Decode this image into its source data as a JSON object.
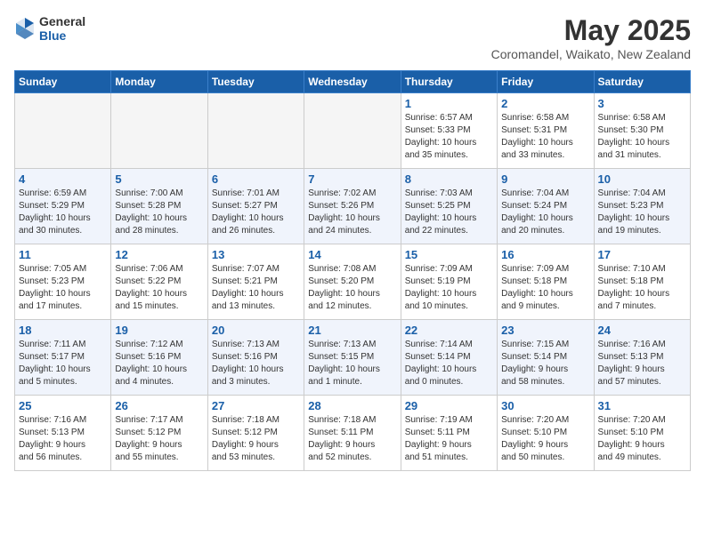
{
  "app": {
    "logo_general": "General",
    "logo_blue": "Blue"
  },
  "header": {
    "month_year": "May 2025",
    "location": "Coromandel, Waikato, New Zealand"
  },
  "days_of_week": [
    "Sunday",
    "Monday",
    "Tuesday",
    "Wednesday",
    "Thursday",
    "Friday",
    "Saturday"
  ],
  "weeks": [
    [
      {
        "num": "",
        "info": "",
        "empty": true
      },
      {
        "num": "",
        "info": "",
        "empty": true
      },
      {
        "num": "",
        "info": "",
        "empty": true
      },
      {
        "num": "",
        "info": "",
        "empty": true
      },
      {
        "num": "1",
        "info": "Sunrise: 6:57 AM\nSunset: 5:33 PM\nDaylight: 10 hours\nand 35 minutes.",
        "empty": false
      },
      {
        "num": "2",
        "info": "Sunrise: 6:58 AM\nSunset: 5:31 PM\nDaylight: 10 hours\nand 33 minutes.",
        "empty": false
      },
      {
        "num": "3",
        "info": "Sunrise: 6:58 AM\nSunset: 5:30 PM\nDaylight: 10 hours\nand 31 minutes.",
        "empty": false
      }
    ],
    [
      {
        "num": "4",
        "info": "Sunrise: 6:59 AM\nSunset: 5:29 PM\nDaylight: 10 hours\nand 30 minutes.",
        "empty": false
      },
      {
        "num": "5",
        "info": "Sunrise: 7:00 AM\nSunset: 5:28 PM\nDaylight: 10 hours\nand 28 minutes.",
        "empty": false
      },
      {
        "num": "6",
        "info": "Sunrise: 7:01 AM\nSunset: 5:27 PM\nDaylight: 10 hours\nand 26 minutes.",
        "empty": false
      },
      {
        "num": "7",
        "info": "Sunrise: 7:02 AM\nSunset: 5:26 PM\nDaylight: 10 hours\nand 24 minutes.",
        "empty": false
      },
      {
        "num": "8",
        "info": "Sunrise: 7:03 AM\nSunset: 5:25 PM\nDaylight: 10 hours\nand 22 minutes.",
        "empty": false
      },
      {
        "num": "9",
        "info": "Sunrise: 7:04 AM\nSunset: 5:24 PM\nDaylight: 10 hours\nand 20 minutes.",
        "empty": false
      },
      {
        "num": "10",
        "info": "Sunrise: 7:04 AM\nSunset: 5:23 PM\nDaylight: 10 hours\nand 19 minutes.",
        "empty": false
      }
    ],
    [
      {
        "num": "11",
        "info": "Sunrise: 7:05 AM\nSunset: 5:23 PM\nDaylight: 10 hours\nand 17 minutes.",
        "empty": false
      },
      {
        "num": "12",
        "info": "Sunrise: 7:06 AM\nSunset: 5:22 PM\nDaylight: 10 hours\nand 15 minutes.",
        "empty": false
      },
      {
        "num": "13",
        "info": "Sunrise: 7:07 AM\nSunset: 5:21 PM\nDaylight: 10 hours\nand 13 minutes.",
        "empty": false
      },
      {
        "num": "14",
        "info": "Sunrise: 7:08 AM\nSunset: 5:20 PM\nDaylight: 10 hours\nand 12 minutes.",
        "empty": false
      },
      {
        "num": "15",
        "info": "Sunrise: 7:09 AM\nSunset: 5:19 PM\nDaylight: 10 hours\nand 10 minutes.",
        "empty": false
      },
      {
        "num": "16",
        "info": "Sunrise: 7:09 AM\nSunset: 5:18 PM\nDaylight: 10 hours\nand 9 minutes.",
        "empty": false
      },
      {
        "num": "17",
        "info": "Sunrise: 7:10 AM\nSunset: 5:18 PM\nDaylight: 10 hours\nand 7 minutes.",
        "empty": false
      }
    ],
    [
      {
        "num": "18",
        "info": "Sunrise: 7:11 AM\nSunset: 5:17 PM\nDaylight: 10 hours\nand 5 minutes.",
        "empty": false
      },
      {
        "num": "19",
        "info": "Sunrise: 7:12 AM\nSunset: 5:16 PM\nDaylight: 10 hours\nand 4 minutes.",
        "empty": false
      },
      {
        "num": "20",
        "info": "Sunrise: 7:13 AM\nSunset: 5:16 PM\nDaylight: 10 hours\nand 3 minutes.",
        "empty": false
      },
      {
        "num": "21",
        "info": "Sunrise: 7:13 AM\nSunset: 5:15 PM\nDaylight: 10 hours\nand 1 minute.",
        "empty": false
      },
      {
        "num": "22",
        "info": "Sunrise: 7:14 AM\nSunset: 5:14 PM\nDaylight: 10 hours\nand 0 minutes.",
        "empty": false
      },
      {
        "num": "23",
        "info": "Sunrise: 7:15 AM\nSunset: 5:14 PM\nDaylight: 9 hours\nand 58 minutes.",
        "empty": false
      },
      {
        "num": "24",
        "info": "Sunrise: 7:16 AM\nSunset: 5:13 PM\nDaylight: 9 hours\nand 57 minutes.",
        "empty": false
      }
    ],
    [
      {
        "num": "25",
        "info": "Sunrise: 7:16 AM\nSunset: 5:13 PM\nDaylight: 9 hours\nand 56 minutes.",
        "empty": false
      },
      {
        "num": "26",
        "info": "Sunrise: 7:17 AM\nSunset: 5:12 PM\nDaylight: 9 hours\nand 55 minutes.",
        "empty": false
      },
      {
        "num": "27",
        "info": "Sunrise: 7:18 AM\nSunset: 5:12 PM\nDaylight: 9 hours\nand 53 minutes.",
        "empty": false
      },
      {
        "num": "28",
        "info": "Sunrise: 7:18 AM\nSunset: 5:11 PM\nDaylight: 9 hours\nand 52 minutes.",
        "empty": false
      },
      {
        "num": "29",
        "info": "Sunrise: 7:19 AM\nSunset: 5:11 PM\nDaylight: 9 hours\nand 51 minutes.",
        "empty": false
      },
      {
        "num": "30",
        "info": "Sunrise: 7:20 AM\nSunset: 5:10 PM\nDaylight: 9 hours\nand 50 minutes.",
        "empty": false
      },
      {
        "num": "31",
        "info": "Sunrise: 7:20 AM\nSunset: 5:10 PM\nDaylight: 9 hours\nand 49 minutes.",
        "empty": false
      }
    ]
  ]
}
